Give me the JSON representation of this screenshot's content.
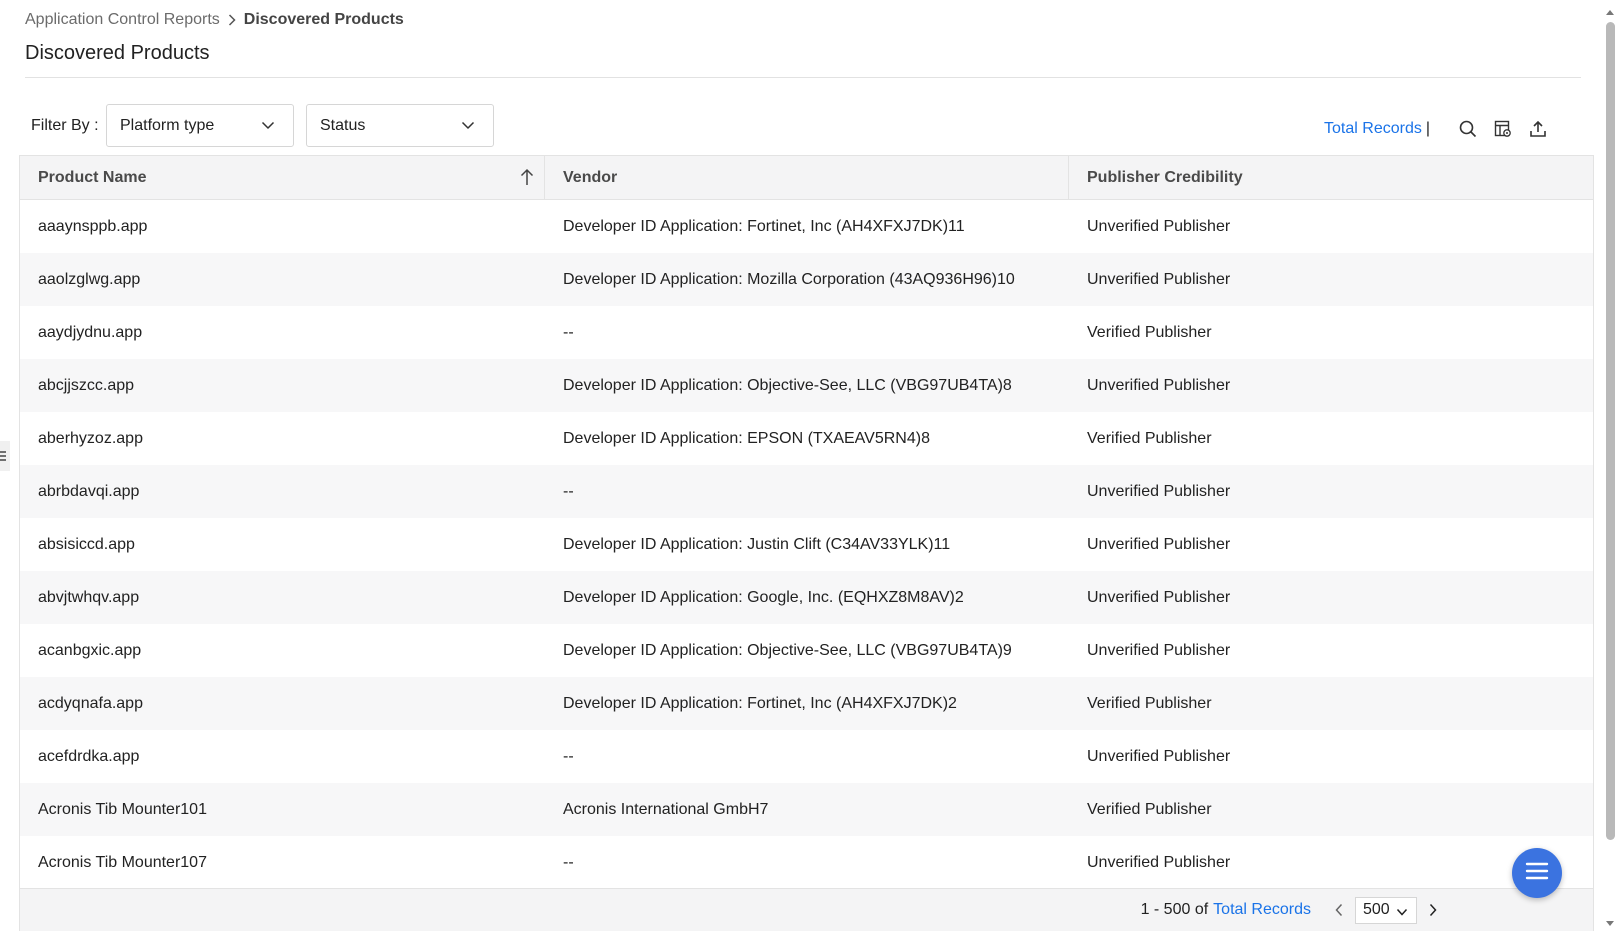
{
  "breadcrumb": {
    "parent": "Application Control Reports",
    "current": "Discovered Products"
  },
  "page": {
    "title": "Discovered Products"
  },
  "filters": {
    "label": "Filter By :",
    "platform_type": "Platform type",
    "status": "Status"
  },
  "toolbar": {
    "total_records": "Total Records",
    "separator": "|",
    "icons": [
      "search-icon",
      "column-settings-icon",
      "export-icon"
    ]
  },
  "table": {
    "columns": [
      "Product Name",
      "Vendor",
      "Publisher Credibility"
    ],
    "sort": {
      "column": "Product Name",
      "direction": "ascending"
    },
    "rows": [
      [
        "aaaynsppb.app",
        "Developer ID Application: Fortinet, Inc (AH4XFXJ7DK)11",
        "Unverified Publisher"
      ],
      [
        "aaolzglwg.app",
        "Developer ID Application: Mozilla Corporation (43AQ936H96)10",
        "Unverified Publisher"
      ],
      [
        "aaydjydnu.app",
        "--",
        "Verified Publisher"
      ],
      [
        "abcjjszcc.app",
        "Developer ID Application: Objective-See, LLC (VBG97UB4TA)8",
        "Unverified Publisher"
      ],
      [
        "aberhyzoz.app",
        "Developer ID Application: EPSON (TXAEAV5RN4)8",
        "Verified Publisher"
      ],
      [
        "abrbdavqi.app",
        "--",
        "Unverified Publisher"
      ],
      [
        "absisiccd.app",
        "Developer ID Application: Justin Clift (C34AV33YLK)11",
        "Unverified Publisher"
      ],
      [
        "abvjtwhqv.app",
        "Developer ID Application: Google, Inc. (EQHXZ8M8AV)2",
        "Unverified Publisher"
      ],
      [
        "acanbgxic.app",
        "Developer ID Application: Objective-See, LLC (VBG97UB4TA)9",
        "Unverified Publisher"
      ],
      [
        "acdyqnafa.app",
        "Developer ID Application: Fortinet, Inc (AH4XFXJ7DK)2",
        "Verified Publisher"
      ],
      [
        "acefdrdka.app",
        "--",
        "Unverified Publisher"
      ],
      [
        "Acronis Tib Mounter101",
        "Acronis International GmbH7",
        "Verified Publisher"
      ],
      [
        "Acronis Tib Mounter107",
        "--",
        "Unverified Publisher"
      ]
    ]
  },
  "pagination": {
    "range": "1 - 500 of",
    "total_link": "Total Records",
    "page_size": "500"
  },
  "colors": {
    "link": "#1a73e8",
    "fab": "#3b73e0",
    "header_bg": "#f4f4f5"
  }
}
